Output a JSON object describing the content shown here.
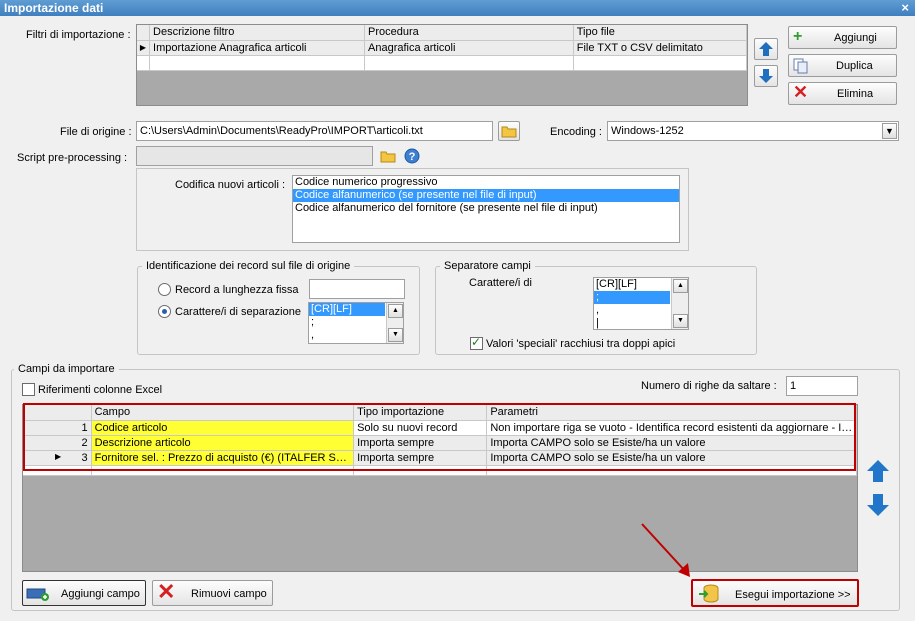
{
  "window": {
    "title": "Importazione dati",
    "close": "×"
  },
  "filters": {
    "label": "Filtri di importazione :",
    "headers": [
      "Descrizione filtro",
      "Procedura",
      "Tipo file"
    ],
    "row": [
      "Importazione Anagrafica articoli",
      "Anagrafica articoli",
      "File TXT o CSV delimitato"
    ],
    "buttons": {
      "add": "Aggiungi",
      "duplicate": "Duplica",
      "delete": "Elimina"
    }
  },
  "source": {
    "file_label": "File di origine :",
    "file_value": "C:\\Users\\Admin\\Documents\\ReadyPro\\IMPORT\\articoli.txt",
    "encoding_label": "Encoding :",
    "encoding_value": "Windows-1252",
    "script_label": "Script pre-processing :"
  },
  "codifica": {
    "label": "Codifica nuovi articoli :",
    "options": [
      "Codice numerico progressivo",
      "Codice alfanumerico (se presente nel file di input)",
      "Codice alfanumerico del fornitore (se presente nel file di input)"
    ],
    "selected_index": 1
  },
  "ident": {
    "title": "Identificazione dei record sul file di origine",
    "radio_fixed": "Record a lunghezza fissa",
    "radio_sep": "Carattere/i di separazione",
    "list": [
      "[CR][LF]",
      ";",
      ","
    ]
  },
  "sep": {
    "title": "Separatore campi",
    "label": "Carattere/i di",
    "list": [
      "[CR][LF]",
      ";",
      ",",
      "|"
    ],
    "checkbox": "Valori 'speciali' racchiusi tra doppi apici"
  },
  "fields": {
    "title": "Campi da importare",
    "excel_label": "Riferimenti colonne Excel",
    "skip_label": "Numero di righe da saltare :",
    "skip_value": "1",
    "headers": [
      "Campo",
      "Tipo importazione",
      "Parametri"
    ],
    "rows": [
      {
        "n": "1",
        "campo": "Codice articolo",
        "tipo": "Solo su nuovi record",
        "param": "Non importare riga se vuoto - Identifica record esistenti da aggiornare - Import..."
      },
      {
        "n": "2",
        "campo": "Descrizione articolo",
        "tipo": "Importa sempre",
        "param": "Importa CAMPO solo se Esiste/ha un valore"
      },
      {
        "n": "3",
        "campo": "Fornitore sel. : Prezzo di acquisto (€) (ITALFER SRL)",
        "tipo": "Importa sempre",
        "param": "Importa CAMPO solo se Esiste/ha un valore"
      }
    ],
    "add_button": "Aggiungi campo",
    "remove_button": "Rimuovi campo",
    "run_button": "Esegui importazione >>"
  },
  "colors": {
    "accent": "#3399ff",
    "highlight": "#ffff33",
    "alert": "#c00000"
  }
}
